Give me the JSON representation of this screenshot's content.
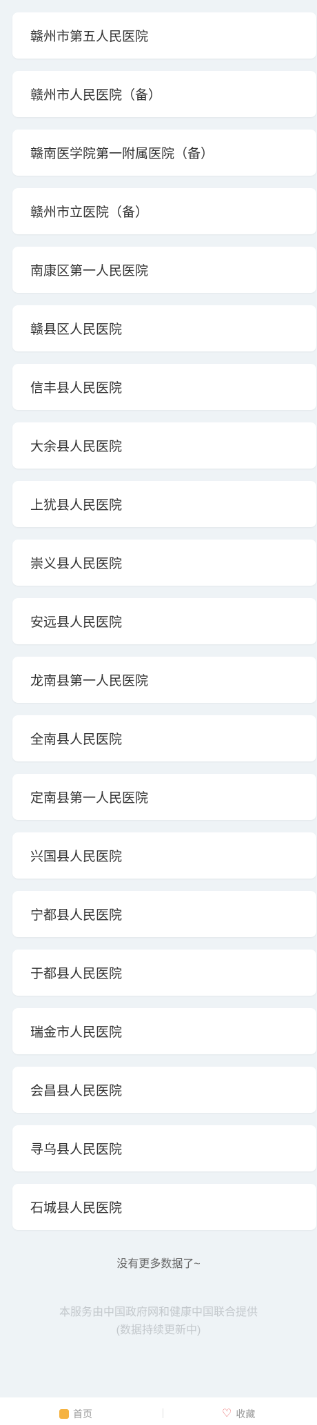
{
  "hospitals": [
    "赣州市第五人民医院",
    "赣州市人民医院（备）",
    "赣南医学院第一附属医院（备）",
    "赣州市立医院（备）",
    "南康区第一人民医院",
    "赣县区人民医院",
    "信丰县人民医院",
    "大余县人民医院",
    "上犹县人民医院",
    "崇义县人民医院",
    "安远县人民医院",
    "龙南县第一人民医院",
    "全南县人民医院",
    "定南县第一人民医院",
    "兴国县人民医院",
    "宁都县人民医院",
    "于都县人民医院",
    "瑞金市人民医院",
    "会昌县人民医院",
    "寻乌县人民医院",
    "石城县人民医院"
  ],
  "status": {
    "no_more": "没有更多数据了~",
    "provider_line1": "本服务由中国政府网和健康中国联合提供",
    "provider_line2": "(数据持续更新中)"
  },
  "tabbar": {
    "home_label": "首页",
    "home_icon": "home-icon",
    "fav_label": "收藏",
    "fav_icon": "heart-icon",
    "fav_color": "#e85a5a"
  }
}
